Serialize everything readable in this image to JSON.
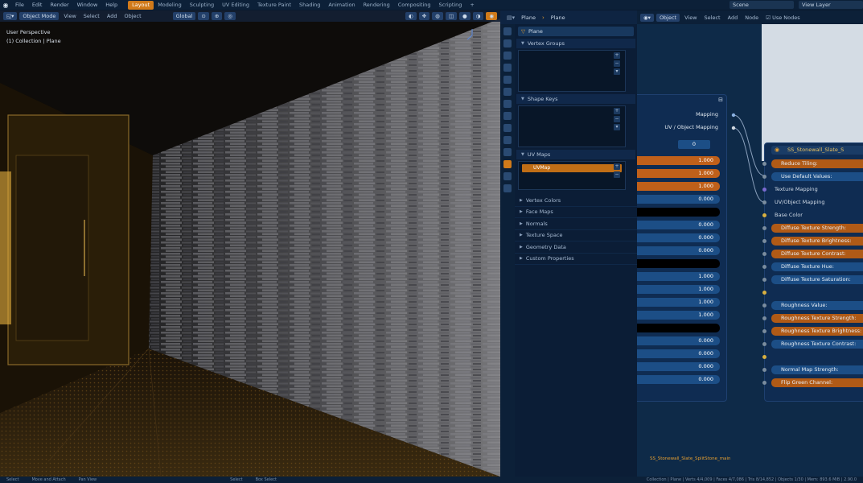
{
  "topbar": {
    "menu": [
      "File",
      "Edit",
      "Render",
      "Window",
      "Help"
    ],
    "workspaces": [
      {
        "label": "Layout",
        "active": true
      },
      {
        "label": "Modeling",
        "active": false
      },
      {
        "label": "Sculpting",
        "active": false
      },
      {
        "label": "UV Editing",
        "active": false
      },
      {
        "label": "Texture Paint",
        "active": false
      },
      {
        "label": "Shading",
        "active": false
      },
      {
        "label": "Animation",
        "active": false
      },
      {
        "label": "Rendering",
        "active": false
      },
      {
        "label": "Compositing",
        "active": false
      },
      {
        "label": "Scripting",
        "active": false
      }
    ],
    "add_tab": "+",
    "scene": "Scene",
    "view_layer": "View Layer"
  },
  "viewport": {
    "mode": "Object Mode",
    "menu": [
      "View",
      "Select",
      "Add",
      "Object"
    ],
    "orientation": "Global",
    "overlay_line1": "User Perspective",
    "overlay_line2": "(1) Collection | Plane"
  },
  "properties": {
    "header_left": "Plane",
    "header_right": "Plane",
    "data_name": "Plane",
    "vertex_groups": "Vertex Groups",
    "shape_keys": "Shape Keys",
    "uv_maps": "UV Maps",
    "uv_map_item": "UVMap",
    "subpanels": [
      "Vertex Colors",
      "Face Maps",
      "Normals",
      "Texture Space",
      "Geometry Data",
      "Custom Properties"
    ]
  },
  "node_editor": {
    "mode": "Object",
    "menu": [
      "View",
      "Select",
      "Add",
      "Node"
    ],
    "use_nodes": "Use Nodes",
    "node1": {
      "out_mapping": "Mapping",
      "out_uv": "UV / Object Mapping",
      "field_value": "0",
      "values": [
        "1.000",
        "1.000",
        "1.000",
        "0.000",
        "",
        "0.000",
        "0.000",
        "0.000",
        "",
        "1.000",
        "1.000",
        "1.000",
        "1.000",
        "",
        "0.000",
        "0.000",
        "0.000",
        "0.000"
      ]
    },
    "node2": {
      "title": "SS_Stonewall_Slate_S",
      "rows": [
        {
          "label": "Reduce Tiling:",
          "style": "orange"
        },
        {
          "label": "Use Default Values:",
          "style": "blue"
        },
        {
          "label": "Texture Mapping",
          "style": "label"
        },
        {
          "label": "UV/Object Mapping",
          "style": "label"
        },
        {
          "label": "Base Color",
          "style": "label"
        },
        {
          "label": "Diffuse Texture Strength:",
          "style": "orange"
        },
        {
          "label": "Diffuse Texture Brightness:",
          "style": "orange"
        },
        {
          "label": "Diffuse Texture Contrast:",
          "style": "orange"
        },
        {
          "label": "Diffuse Texture Hue:",
          "style": "blue"
        },
        {
          "label": "Diffuse Texture Saturation:",
          "style": "blue"
        },
        {
          "label": "",
          "style": "label"
        },
        {
          "label": "Roughness Value:",
          "style": "blue"
        },
        {
          "label": "Roughness Texture Strength:",
          "style": "orange"
        },
        {
          "label": "Roughness Texture Brightness:",
          "style": "orange"
        },
        {
          "label": "Roughness Texture Contrast:",
          "style": "blue"
        },
        {
          "label": "",
          "style": "label"
        },
        {
          "label": "Normal Map Strength:",
          "style": "blue"
        },
        {
          "label": "Flip Green Channel:",
          "style": "orange"
        }
      ]
    },
    "caption": "SS_Stonewall_Slate_SplitStone_main"
  },
  "statusbar": {
    "items": [
      "Select",
      "Move and Attach",
      "Pan View",
      "Select",
      "Box Select"
    ],
    "stats": "Collection | Plane | Verts 4/4,009 | Faces 4/7,086 | Tris 8/14,852 | Objects 1/30 | Mem: 893.6 MiB | 2.90.0"
  }
}
